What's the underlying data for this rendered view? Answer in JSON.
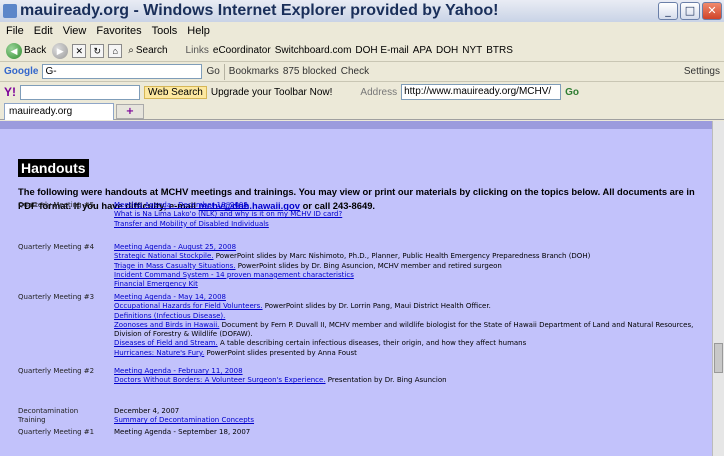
{
  "window": {
    "title": "mauiready.org - Windows Internet Explorer provided by Yahoo!",
    "min_label": "_",
    "max_label": "□",
    "close_label": "✕"
  },
  "menu": [
    "File",
    "Edit",
    "View",
    "Favorites",
    "Tools",
    "Help"
  ],
  "nav": {
    "back_label": "Back",
    "search_label": "Search",
    "links_label": "Links",
    "links": [
      "eCoordinator",
      "Switchboard.com",
      "DOH E-mail",
      "APA",
      "DOH",
      "NYT",
      "BTRS"
    ]
  },
  "google_bar": {
    "logo": "Google",
    "input_value": "G-",
    "go_label": "Go",
    "bookmarks_label": "Bookmarks",
    "blocked_label": "875 blocked",
    "check_label": "Check",
    "settings_label": "Settings"
  },
  "yahoo_bar": {
    "logo": "Y!",
    "web_search_label": "Web Search",
    "upgrade_label": "Upgrade your Toolbar Now!",
    "address_label": "Address",
    "address_value": "http://www.mauiready.org/MCHV/",
    "go_label": "Go"
  },
  "tab": {
    "label": "mauiready.org",
    "new_tab_label": "+"
  },
  "page": {
    "heading": "Handouts",
    "intro_text": "The following were handouts at MCHV meetings and trainings. You may view or print our materials by clicking on the topics below. All documents are in PDF format. If you have difficulty, e-mail",
    "intro_email": "mchv@doh.hawaii.gov",
    "intro_tail": "or call 243-8649.",
    "sections": [
      {
        "label": "Quarterly Meeting #5",
        "items": [
          {
            "link": "Meeting Agenda - December 18, 2008",
            "desc": ""
          },
          {
            "link": "What is Na Lima Lako'o (NLK) and why is it on my MCHV ID card?",
            "desc": ""
          },
          {
            "link": "Transfer and Mobility of Disabled Individuals",
            "desc": ""
          }
        ]
      },
      {
        "label": "Quarterly Meeting #4",
        "items": [
          {
            "link": "Meeting Agenda - August 25, 2008",
            "desc": ""
          },
          {
            "link": "Strategic National Stockpile.",
            "desc": "PowerPoint slides by Marc Nishimoto, Ph.D., Planner, Public Health Emergency Preparedness Branch (DOH)"
          },
          {
            "link": "Triage in Mass Casualty Situations.",
            "desc": "PowerPoint slides by Dr. Bing Asuncion, MCHV member and retired surgeon"
          },
          {
            "link": "Incident Command System - 14 proven management characteristics",
            "desc": ""
          },
          {
            "link": "Financial Emergency Kit",
            "desc": ""
          }
        ]
      },
      {
        "label": "Quarterly Meeting #3",
        "items": [
          {
            "link": "Meeting Agenda - May 14, 2008",
            "desc": ""
          },
          {
            "link": "Occupational Hazards for Field Volunteers.",
            "desc": "PowerPoint slides by Dr. Lorrin Pang, Maui District Health Officer."
          },
          {
            "link": "Definitions (Infectious Disease).",
            "desc": ""
          },
          {
            "link": "Zoonoses and Birds in Hawaii.",
            "desc": "Document by Fern P. Duvall II, MCHV member and wildlife biologist for the State of Hawaii Department of Land and Natural Resources, Division of Forestry & Wildlife (DOFAW)."
          },
          {
            "link": "Diseases of Field and Stream.",
            "desc": "A table describing certain infectious diseases, their origin, and how they affect humans"
          },
          {
            "link": "Hurricanes: Nature's Fury.",
            "desc": "PowerPoint slides presented by Anna Foust"
          }
        ]
      },
      {
        "label": "Quarterly Meeting #2",
        "items": [
          {
            "link": "Meeting Agenda - February 11, 2008",
            "desc": ""
          },
          {
            "link": "Doctors Without Borders: A Volunteer Surgeon's Experience.",
            "desc": "Presentation by Dr. Bing Asuncion"
          }
        ]
      },
      {
        "label": "Decontamination Training",
        "items": [
          {
            "link": "",
            "desc": "December 4, 2007"
          },
          {
            "link": "Summary of Decontamination Concepts",
            "desc": ""
          }
        ]
      },
      {
        "label": "Quarterly Meeting #1",
        "items": [
          {
            "link": "",
            "desc": "Meeting Agenda - September 18, 2007"
          }
        ]
      }
    ]
  }
}
